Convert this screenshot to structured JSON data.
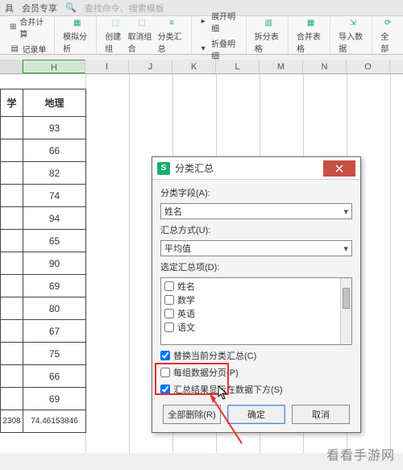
{
  "toolbar": {
    "tab1": "具",
    "tab2": "会员专享",
    "search_ph": "查找命令、搜索模板"
  },
  "ribbon": {
    "mergeCalc": "合并计算",
    "record": "记录单",
    "simulate": "模拟分析",
    "createGroup": "创建组",
    "ungroup": "取消组合",
    "subtotal": "分类汇总",
    "showDetail": "展开明细",
    "hideDetail": "折叠明细",
    "splitTable": "拆分表格",
    "mergeTable": "合并表格",
    "importData": "导入数据",
    "allRefresh": "全部"
  },
  "columns": {
    "H": "H",
    "I": "I",
    "J": "J",
    "K": "K",
    "L": "L",
    "M": "M",
    "N": "N",
    "O": "O"
  },
  "table": {
    "header_left": "学",
    "header_H": "地理",
    "rows": [
      "93",
      "66",
      "82",
      "74",
      "94",
      "65",
      "90",
      "69",
      "80",
      "67",
      "75",
      "66",
      "69"
    ],
    "footer_left": "2308",
    "footer_H": "74.46153846"
  },
  "dialog": {
    "title": "分类汇总",
    "field_label": "分类字段(A):",
    "field_value": "姓名",
    "method_label": "汇总方式(U):",
    "method_value": "平均值",
    "items_label": "选定汇总项(D):",
    "items": [
      "姓名",
      "数学",
      "英语",
      "语文"
    ],
    "cb_replace": "替换当前分类汇总(C)",
    "cb_pagebreak": "每组数据分页(P)",
    "cb_below": "汇总结果显示在数据下方(S)",
    "btn_removeAll": "全部删除(R)",
    "btn_ok": "确定",
    "btn_cancel": "取消"
  },
  "watermark": "看看手游网"
}
